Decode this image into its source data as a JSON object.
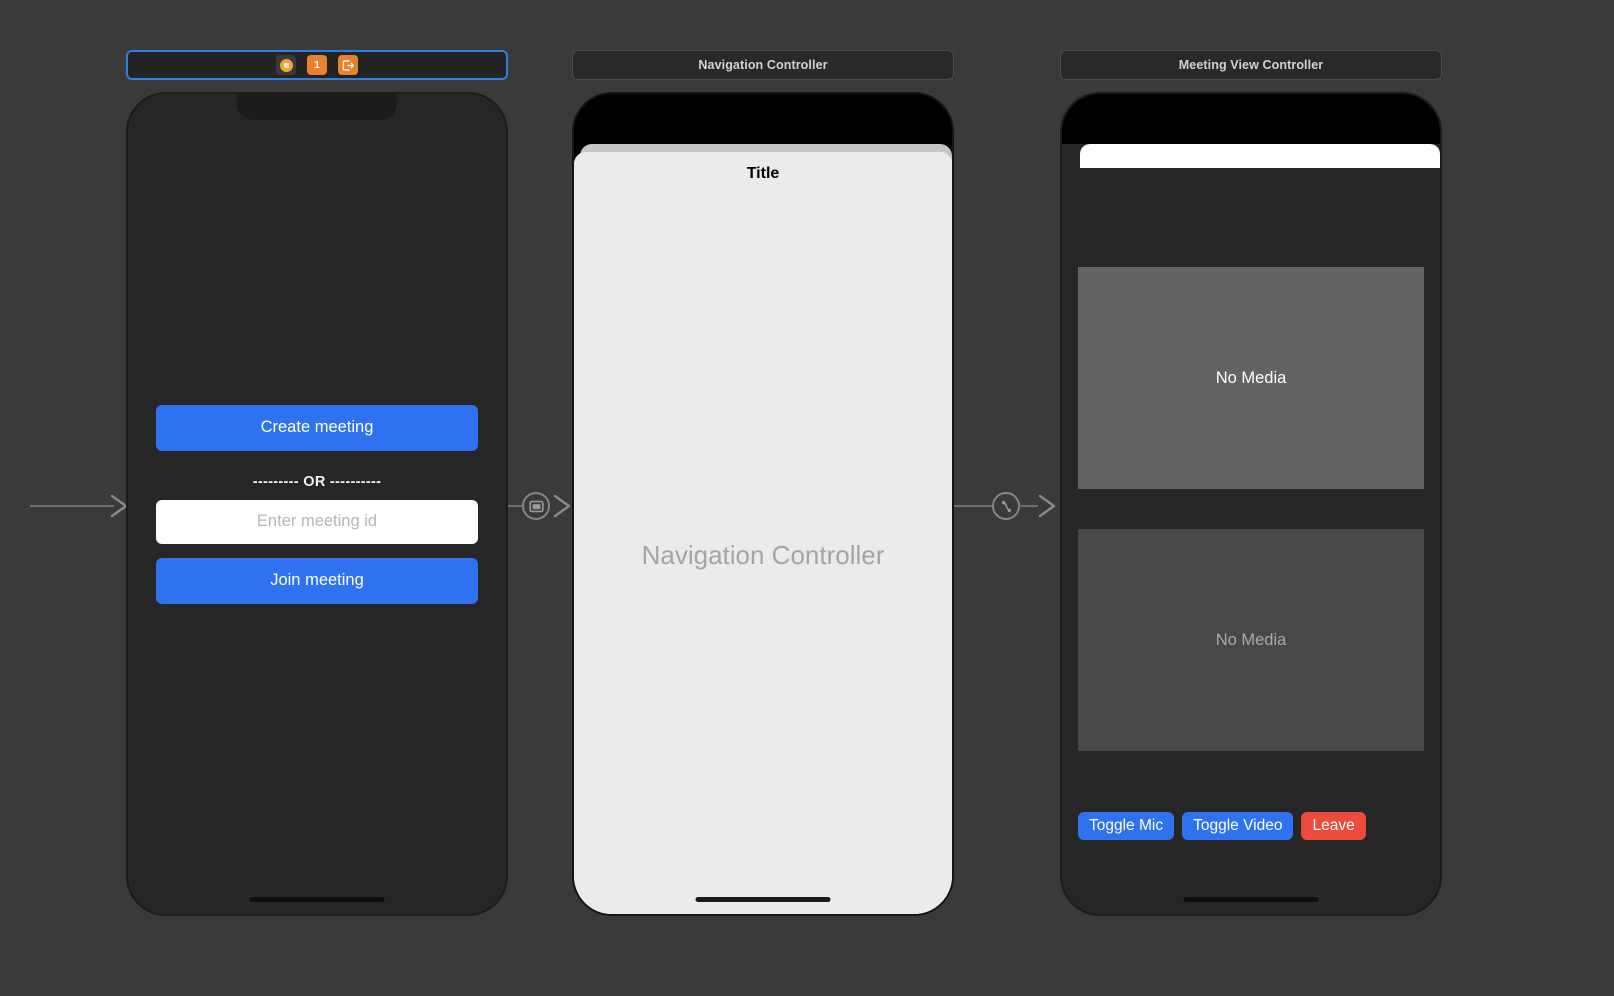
{
  "canvas": {
    "background": "#3a3a3a",
    "accent_blue": "#2f72f0",
    "accent_red": "#ef4b3c",
    "selection_blue": "#2f7fe0",
    "xcode_orange": "#e8822e"
  },
  "scenes": [
    {
      "id": "entry",
      "dock": {
        "title": "",
        "selected": true,
        "icons": [
          {
            "name": "view-controller-icon",
            "glyph": "circle"
          },
          {
            "name": "first-responder-icon",
            "glyph": "1"
          },
          {
            "name": "exit-icon",
            "glyph": "exit-arrow"
          }
        ]
      },
      "content": {
        "create_button": "Create meeting",
        "or_separator": "--------- OR ----------",
        "meeting_id_value": "",
        "meeting_id_placeholder": "Enter meeting id",
        "join_button": "Join meeting"
      }
    },
    {
      "id": "navigation",
      "dock": {
        "title": "Navigation Controller",
        "selected": false
      },
      "content": {
        "nav_bar_title": "Title",
        "body_label": "Navigation Controller"
      }
    },
    {
      "id": "meeting",
      "dock": {
        "title": "Meeting View Controller",
        "selected": false
      },
      "content": {
        "media_tiles": [
          {
            "label": "No Media",
            "state": "active"
          },
          {
            "label": "No Media",
            "state": "inactive"
          }
        ],
        "controls": [
          {
            "label": "Toggle Mic",
            "style": "blue"
          },
          {
            "label": "Toggle Video",
            "style": "blue"
          },
          {
            "label": "Leave",
            "style": "red"
          }
        ]
      }
    }
  ],
  "connectors": [
    {
      "id": "entry-point",
      "type": "storyboard-entry-point",
      "badge": "none"
    },
    {
      "id": "entry-to-navigation",
      "type": "present-modally-segue",
      "badge": "rectangle"
    },
    {
      "id": "navigation-to-meeting",
      "type": "relationship-root-view-controller",
      "badge": "relationship"
    }
  ]
}
